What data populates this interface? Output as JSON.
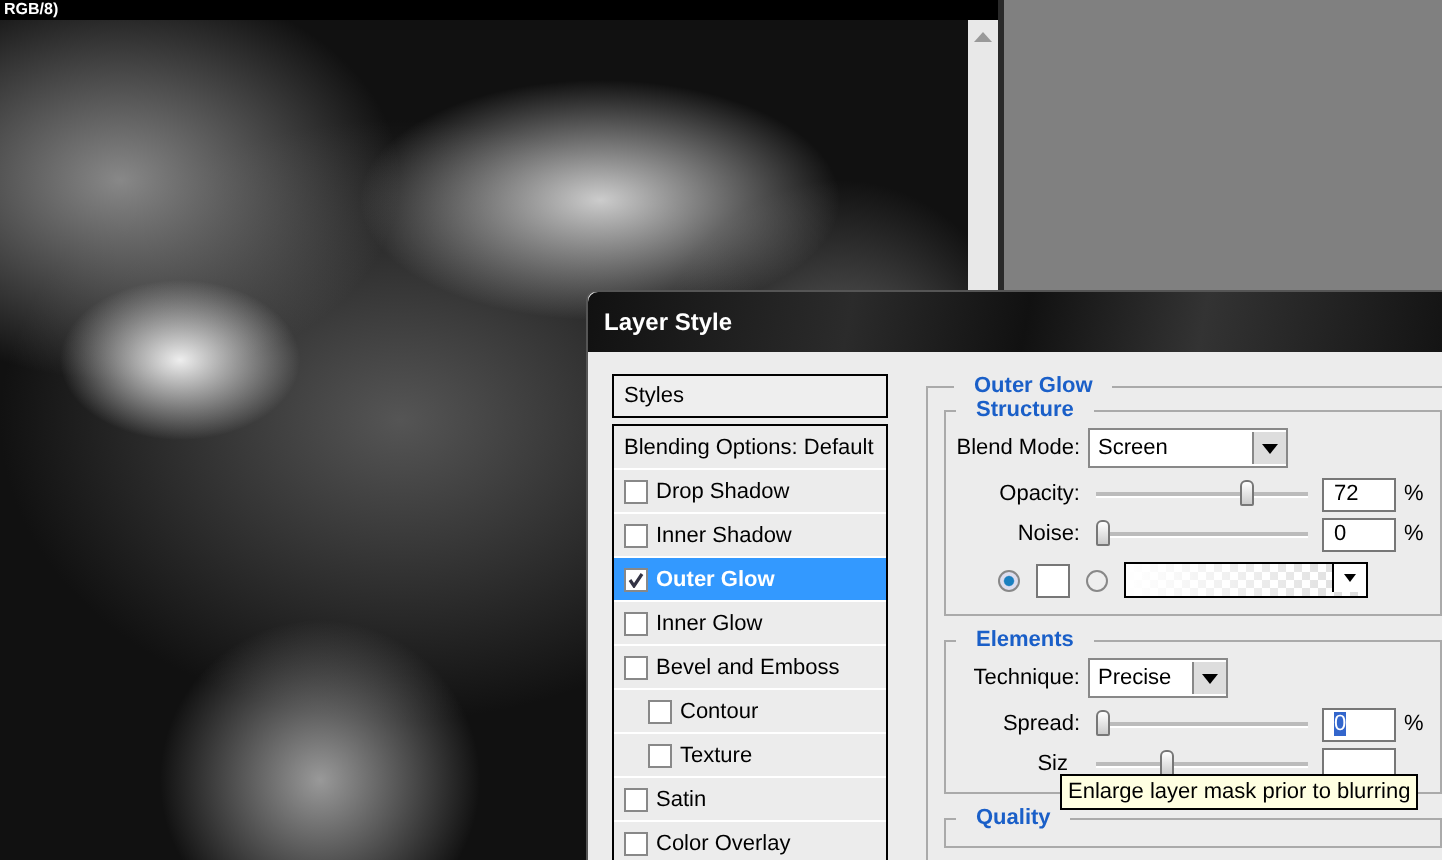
{
  "document": {
    "title": "RGB/8)"
  },
  "dialog": {
    "title": "Layer Style",
    "styles_header": "Styles",
    "style_items": [
      {
        "label": "Blending Options: Default",
        "kind": "plain",
        "selected": false
      },
      {
        "label": "Drop Shadow",
        "kind": "effect",
        "checked": false,
        "selected": false
      },
      {
        "label": "Inner Shadow",
        "kind": "effect",
        "checked": false,
        "selected": false
      },
      {
        "label": "Outer Glow",
        "kind": "effect",
        "checked": true,
        "selected": true
      },
      {
        "label": "Inner Glow",
        "kind": "effect",
        "checked": false,
        "selected": false
      },
      {
        "label": "Bevel and Emboss",
        "kind": "effect",
        "checked": false,
        "selected": false,
        "children": [
          {
            "label": "Contour",
            "kind": "effect",
            "checked": false,
            "selected": false
          },
          {
            "label": "Texture",
            "kind": "effect",
            "checked": false,
            "selected": false
          }
        ]
      },
      {
        "label": "Satin",
        "kind": "effect",
        "checked": false,
        "selected": false
      },
      {
        "label": "Color Overlay",
        "kind": "effect",
        "checked": false,
        "selected": false
      }
    ],
    "panel": {
      "title": "Outer Glow",
      "structure": {
        "title": "Structure",
        "blend_mode": {
          "label": "Blend Mode:",
          "value": "Screen"
        },
        "opacity": {
          "label": "Opacity:",
          "level": 0.72,
          "value": "72",
          "unit": "%"
        },
        "noise": {
          "label": "Noise:",
          "level": 0,
          "value": "0",
          "unit": "%"
        },
        "fill_options": [
          {
            "kind": "solid",
            "selected": true
          },
          {
            "kind": "gradient",
            "selected": false
          }
        ]
      },
      "elements": {
        "title": "Elements",
        "technique": {
          "label": "Technique:",
          "value": "Precise"
        },
        "spread": {
          "label": "Spread:",
          "level": 0,
          "value": "0",
          "unit": "%",
          "text_selected": true
        },
        "size": {
          "label": "Siz",
          "level": 0.32
        }
      },
      "quality": {
        "title": "Quality"
      }
    },
    "tooltip": "Enlarge layer mask prior to blurring"
  }
}
